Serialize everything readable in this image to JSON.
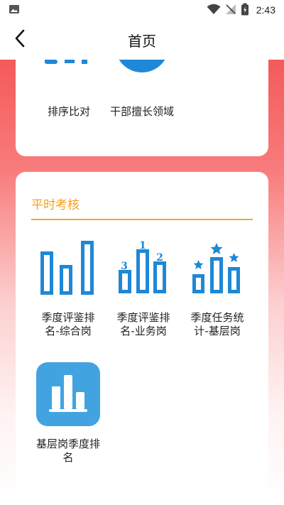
{
  "status_bar": {
    "time": "2:43",
    "icons": [
      "image-icon",
      "wifi-icon",
      "signal-off-icon",
      "battery-charging-icon"
    ]
  },
  "app_bar": {
    "title": "首页",
    "back_icon": "chevron-left-icon"
  },
  "top_card": {
    "items": [
      {
        "label": "排序比对",
        "icon": "ranking-compare-icon"
      },
      {
        "label": "干部擅长领域",
        "icon": "star-badge-icon"
      }
    ]
  },
  "routine_section": {
    "title": "平时考核",
    "accent_color": "#f0a020",
    "items": [
      {
        "label": "季度评鉴排名-综合岗",
        "line1": "季度评鉴排",
        "line2": "名-综合岗",
        "icon": "bar-chart-icon"
      },
      {
        "label": "季度评鉴排名-业务岗",
        "line1": "季度评鉴排",
        "line2": "名-业务岗",
        "icon": "podium-icon",
        "podium_numbers": [
          "1",
          "2",
          "3"
        ]
      },
      {
        "label": "季度任务统计-基层岗",
        "line1": "季度任务统",
        "line2": "计-基层岗",
        "icon": "star-bars-icon"
      },
      {
        "label": "基层岗季度排名",
        "line1": "基层岗季度排",
        "line2": "名",
        "icon": "bar-tile-icon"
      }
    ]
  },
  "colors": {
    "icon_blue": "#1e88d6",
    "tile_blue": "#43a3e0",
    "gradient_top": "#f45a5a"
  }
}
